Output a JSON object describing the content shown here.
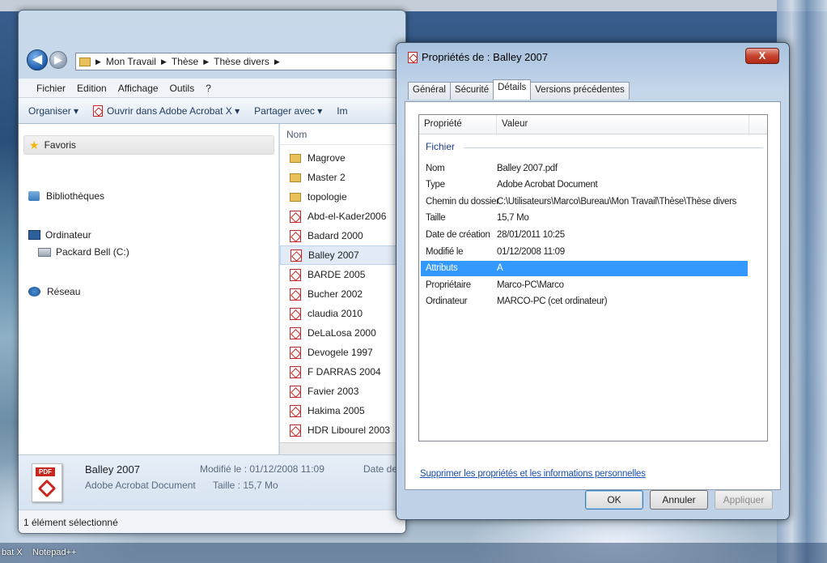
{
  "explorer": {
    "breadcrumb": [
      "Mon Travail",
      "Thèse",
      "Thèse divers"
    ],
    "menu": [
      "Fichier",
      "Edition",
      "Affichage",
      "Outils",
      "?"
    ],
    "toolbar": {
      "organise": "Organiser ▾",
      "open_with": "Ouvrir dans Adobe Acrobat X ▾",
      "share": "Partager avec ▾",
      "truncated": "Im"
    },
    "nav": {
      "favorites": "Favoris",
      "libraries": "Bibliothèques",
      "computer": "Ordinateur",
      "drive": "Packard Bell (C:)",
      "network": "Réseau"
    },
    "column_name": "Nom",
    "files": [
      {
        "name": "Magrove",
        "kind": "folder"
      },
      {
        "name": "Master 2",
        "kind": "folder"
      },
      {
        "name": "topologie",
        "kind": "folder"
      },
      {
        "name": "Abd-el-Kader2006",
        "kind": "pdf"
      },
      {
        "name": "Badard 2000",
        "kind": "pdf"
      },
      {
        "name": "Balley 2007",
        "kind": "pdf"
      },
      {
        "name": "BARDE 2005",
        "kind": "pdf"
      },
      {
        "name": "Bucher 2002",
        "kind": "pdf"
      },
      {
        "name": "claudia 2010",
        "kind": "pdf"
      },
      {
        "name": "DeLaLosa 2000",
        "kind": "pdf"
      },
      {
        "name": "Devogele 1997",
        "kind": "pdf"
      },
      {
        "name": "F DARRAS 2004",
        "kind": "pdf"
      },
      {
        "name": "Favier 2003",
        "kind": "pdf"
      },
      {
        "name": "Hakima 2005",
        "kind": "pdf"
      },
      {
        "name": "HDR Libourel 2003",
        "kind": "pdf"
      }
    ],
    "details": {
      "name": "Balley 2007",
      "type": "Adobe Acrobat Document",
      "modified": "Modifié le : 01/12/2008 11:09",
      "size": "Taille : 15,7 Mo",
      "date_trunc": "Date de",
      "pdf_tag": "PDF"
    },
    "status": "1 élément sélectionné"
  },
  "dialog": {
    "title": "Propriétés de : Balley 2007",
    "close": "X",
    "tabs": [
      "Général",
      "Sécurité",
      "Détails",
      "Versions précédentes"
    ],
    "active_tab": "Détails",
    "col_property": "Propriété",
    "col_value": "Valeur",
    "group": "Fichier",
    "rows": [
      {
        "k": "Nom",
        "v": "Balley 2007.pdf"
      },
      {
        "k": "Type",
        "v": "Adobe Acrobat Document"
      },
      {
        "k": "Chemin du dossier",
        "v": "C:\\Utilisateurs\\Marco\\Bureau\\Mon Travail\\Thèse\\Thèse divers"
      },
      {
        "k": "Taille",
        "v": "15,7 Mo"
      },
      {
        "k": "Date de création",
        "v": "28/01/2011 10:25"
      },
      {
        "k": "Modifié le",
        "v": "01/12/2008 11:09"
      },
      {
        "k": "Attributs",
        "v": "A"
      },
      {
        "k": "Propriétaire",
        "v": "Marco-PC\\Marco"
      },
      {
        "k": "Ordinateur",
        "v": "MARCO-PC (cet ordinateur)"
      }
    ],
    "selected_row": "Attributs",
    "link": "Supprimer les propriétés et les informations personnelles",
    "buttons": {
      "ok": "OK",
      "cancel": "Annuler",
      "apply": "Appliquer"
    }
  },
  "taskbar": {
    "item1": "bat X",
    "item2": "Notepad++"
  }
}
